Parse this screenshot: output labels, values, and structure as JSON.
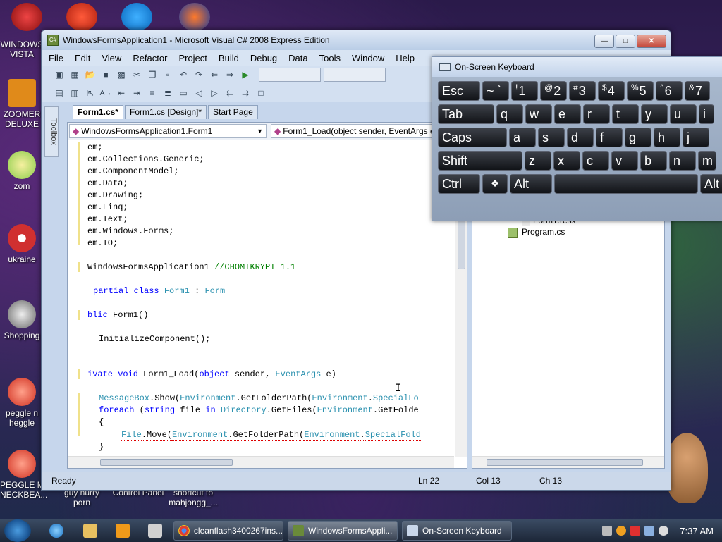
{
  "desktop_icons": [
    {
      "label": "WINDOWS\nVISTA",
      "color": "#c0c8d4"
    },
    {
      "label": "ZOOMER\nDELUXE",
      "color": "#e08a1a"
    },
    {
      "label": "zom",
      "color": "#8acc4a"
    },
    {
      "label": "ukraine",
      "color": "#d03030"
    },
    {
      "label": "Shopping",
      "color": "#8a8a8a"
    },
    {
      "label": "peggle n\nheggle",
      "color": "#e04a3a"
    },
    {
      "label": "PEGGLE M\nNECKBEA...",
      "color": "#e04a3a"
    }
  ],
  "desktop_bottom_labels": [
    "guy hurry\nporn",
    "Control Panel",
    "shortcut to\nmahjongg_..."
  ],
  "window": {
    "title": "WindowsFormsApplication1 - Microsoft Visual C# 2008 Express Edition",
    "menu": [
      "File",
      "Edit",
      "View",
      "Refactor",
      "Project",
      "Build",
      "Debug",
      "Data",
      "Tools",
      "Window",
      "Help"
    ],
    "tabs": [
      "Form1.cs*",
      "Form1.cs [Design]*",
      "Start Page"
    ],
    "toolbox_label": "Toolbox",
    "class_dropdown": "WindowsFormsApplication1.Form1",
    "member_dropdown": "Form1_Load(object sender, EventArgs e)",
    "solution_items": [
      "Form1.resx",
      "Program.cs"
    ],
    "status": {
      "ready": "Ready",
      "ln": "Ln 22",
      "col": "Col 13",
      "ch": "Ch 13"
    }
  },
  "code_lines": [
    "em;",
    "em.Collections.Generic;",
    "em.ComponentModel;",
    "em.Data;",
    "em.Drawing;",
    "em.Linq;",
    "em.Text;",
    "em.Windows.Forms;",
    "em.IO;"
  ],
  "code": {
    "ns_text": "WindowsFormsApplication1 ",
    "ns_comment": "//CHOMIKRYPT 1.1",
    "class_kw": "partial class ",
    "class_name": "Form1",
    "class_sep": " : ",
    "class_base": "Form",
    "ctor_kw": "blic ",
    "ctor_name": "Form1()",
    "init": "InitializeComponent();",
    "load_kw1": "ivate void ",
    "load_name": "Form1_Load(",
    "load_kw2": "object",
    "load_rest": " sender, ",
    "load_type": "EventArgs",
    "load_end": " e)",
    "mb_1": "MessageBox",
    "mb_2": ".Show(",
    "mb_3": "Environment",
    "mb_4": ".GetFolderPath(",
    "mb_5": "Environment",
    "mb_6": ".",
    "mb_7": "SpecialFo",
    "fe_kw1": "foreach",
    "fe_2": " (",
    "fe_kw3": "string",
    "fe_4": " file ",
    "fe_kw5": "in",
    "fe_6": " ",
    "fe_7": "Directory",
    "fe_8": ".GetFiles(",
    "fe_9": "Environment",
    "fe_10": ".GetFolde",
    "brace_open": "{",
    "fm_1": "File",
    "fm_2": ".Move(",
    "fm_3": "Environment",
    "fm_4": ".GetFolderPath(",
    "fm_5": "Environment",
    "fm_6": ".",
    "fm_7": "SpecialFold",
    "brace_close": "}"
  },
  "osk": {
    "title": "On-Screen Keyboard",
    "row1": [
      [
        "Esc",
        ""
      ],
      [
        "~ `",
        ""
      ],
      [
        "1",
        "!"
      ],
      [
        "2",
        "@"
      ],
      [
        "3",
        "#"
      ],
      [
        "4",
        "$"
      ],
      [
        "5",
        "%"
      ],
      [
        "6",
        "^"
      ],
      [
        "7",
        "&"
      ]
    ],
    "row2": [
      "Tab",
      "q",
      "w",
      "e",
      "r",
      "t",
      "y",
      "u",
      "i"
    ],
    "row3": [
      "Caps",
      "a",
      "s",
      "d",
      "f",
      "g",
      "h",
      "j"
    ],
    "row4": [
      "Shift",
      "z",
      "x",
      "c",
      "v",
      "b",
      "n",
      "m"
    ],
    "row5": [
      "Ctrl",
      "win",
      "Alt",
      "",
      "Alt"
    ]
  },
  "taskbar": {
    "tasks": [
      "cleanflash3400267ins...",
      "WindowsFormsAppli...",
      "On-Screen Keyboard"
    ],
    "clock": "7:37 AM"
  }
}
